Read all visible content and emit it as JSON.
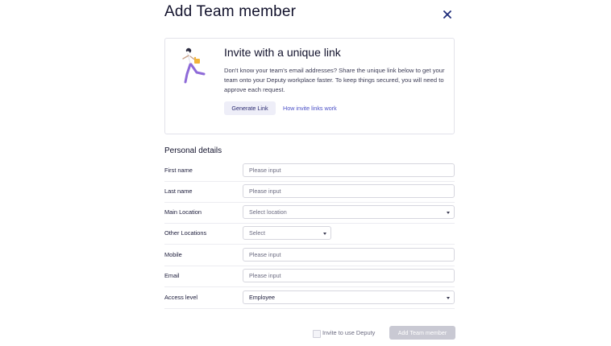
{
  "modal": {
    "title": "Add Team member"
  },
  "invite_card": {
    "title": "Invite with a unique link",
    "description": "Don't know your team's email addresses? Share the unique link below to get your team onto your Deputy workplace faster. To keep things secured, you will need to approve each request.",
    "generate_label": "Generate Link",
    "how_link_label": "How invite links work"
  },
  "personal_details": {
    "section_title": "Personal details",
    "fields": [
      {
        "label": "First name",
        "placeholder": "Please input",
        "type": "input"
      },
      {
        "label": "Last name",
        "placeholder": "Please input",
        "type": "input"
      },
      {
        "label": "Main Location",
        "placeholder": "Select location",
        "type": "select"
      },
      {
        "label": "Other Locations",
        "placeholder": "Select",
        "type": "select"
      },
      {
        "label": "Mobile",
        "placeholder": "Please input",
        "type": "input"
      },
      {
        "label": "Email",
        "placeholder": "Please input",
        "type": "input"
      },
      {
        "label": "Access level",
        "value": "Employee",
        "type": "select"
      }
    ]
  },
  "footer": {
    "invite_checkbox_label": "Invite to use Deputy",
    "invite_checked": false,
    "submit_label": "Add Team member"
  },
  "colors": {
    "accent": "#4a4fc6",
    "title": "#12122c",
    "disabled_button": "#c9c9d3",
    "illustration_purple": "#8e6ad8",
    "illustration_yellow": "#f2b43a"
  }
}
